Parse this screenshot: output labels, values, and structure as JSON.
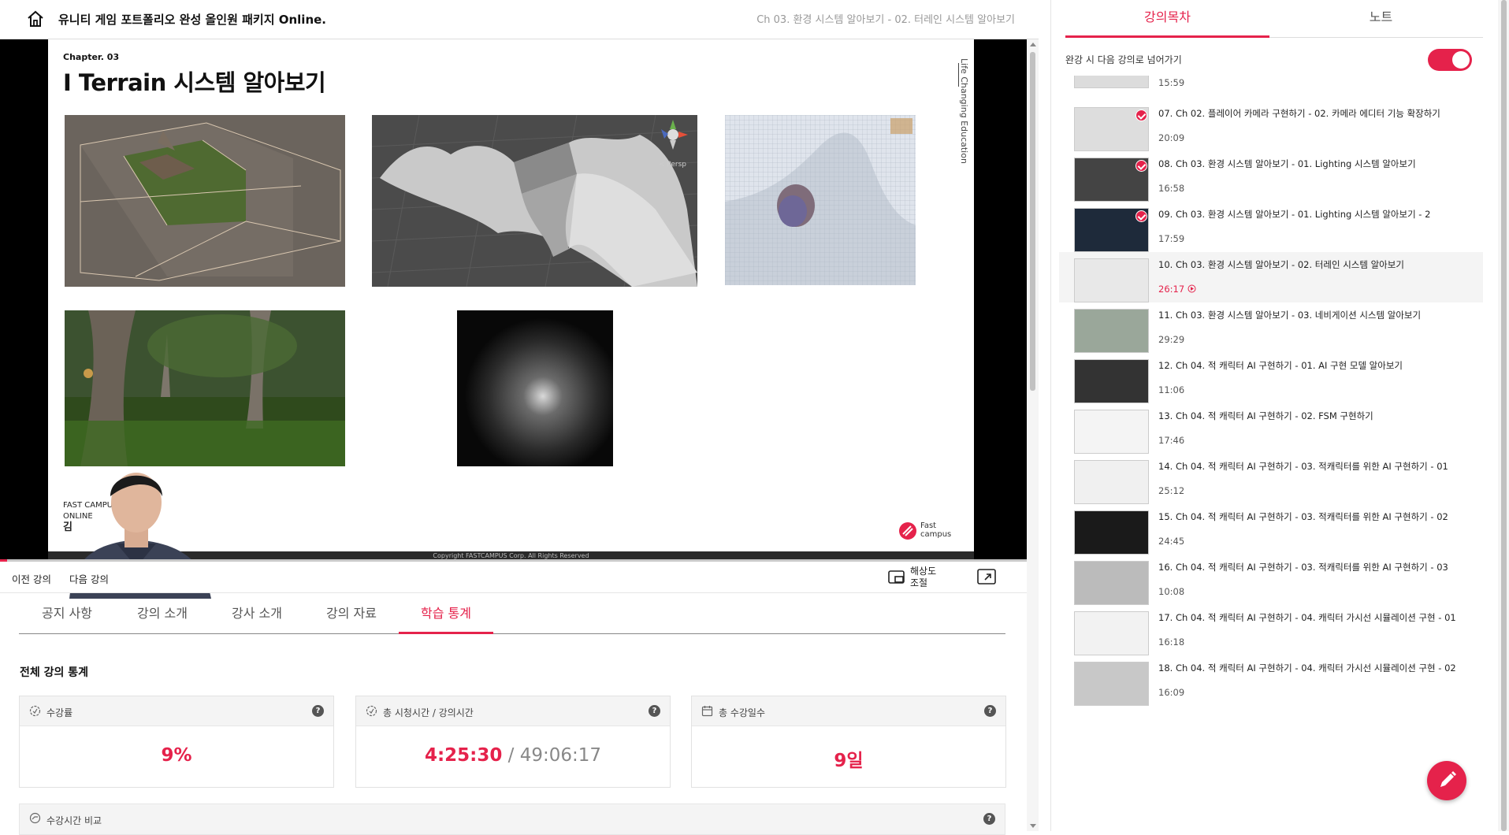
{
  "header": {
    "course_title": "유니티 게임 포트폴리오 완성 올인원 패키지 Online.",
    "current_lecture": "Ch 03. 환경 시스템 알아보기 - 02. 터레인 시스템 알아보기"
  },
  "slide": {
    "chapter_label": "Chapter.   03",
    "title": "I Terrain 시스템 알아보기",
    "side_caption": "Life Changing Education",
    "footer_line1": "FAST CAMPUS",
    "footer_line2": "ONLINE",
    "footer_line3": "김",
    "logo_text_1": "Fast",
    "logo_text_2": "campus",
    "copyright": "Copyright FASTCAMPUS Corp. All Rights Reserved",
    "persp_label": "< Persp"
  },
  "player": {
    "progress_fraction": 0.007
  },
  "controls": {
    "prev_label": "이전 강의",
    "next_label": "다음 강의",
    "resolution_label_1": "해상도",
    "resolution_label_2": "조절"
  },
  "tabs": [
    {
      "label": "공지 사항"
    },
    {
      "label": "강의 소개"
    },
    {
      "label": "강사 소개"
    },
    {
      "label": "강의 자료"
    },
    {
      "label": "학습 통계"
    }
  ],
  "stats": {
    "heading": "전체 강의 통계",
    "progress_label": "수강률",
    "progress_value": "9%",
    "watch_label": "총 시청시간 / 강의시간",
    "watch_value": "4:25:30",
    "watch_separator": " / ",
    "total_value": "49:06:17",
    "days_label": "총 수강일수",
    "days_value": "9일",
    "compare_label": "수강시간 비교",
    "help": "?"
  },
  "sidebar": {
    "tab_curriculum": "강의목차",
    "tab_notes": "노트",
    "autoplay_label": "완강 시 다음 강의로 넘어가기",
    "partial_duration": "15:59",
    "lectures": [
      {
        "title": "07. Ch 02. 플레이어 카메라 구현하기 - 02. 카메라 에디터 기능 확장하기",
        "duration": "20:09"
      },
      {
        "title": "08. Ch 03. 환경 시스템 알아보기 - 01. Lighting 시스템 알아보기",
        "duration": "16:58"
      },
      {
        "title": "09. Ch 03. 환경 시스템 알아보기 - 01. Lighting 시스템 알아보기 - 2",
        "duration": "17:59"
      },
      {
        "title": "10. Ch 03. 환경 시스템 알아보기 - 02. 터레인 시스템 알아보기",
        "duration": "26:17"
      },
      {
        "title": "11. Ch 03. 환경 시스템 알아보기 - 03. 네비게이션 시스템 알아보기",
        "duration": "29:29"
      },
      {
        "title": "12. Ch 04. 적 캐릭터 AI 구현하기 - 01. AI 구현 모델 알아보기",
        "duration": "11:06"
      },
      {
        "title": "13. Ch 04. 적 캐릭터 AI 구현하기 - 02. FSM 구현하기",
        "duration": "17:46"
      },
      {
        "title": "14. Ch 04. 적 캐릭터 AI 구현하기 - 03. 적캐릭터를 위한 AI 구현하기 - 01",
        "duration": "25:12"
      },
      {
        "title": "15. Ch 04. 적 캐릭터 AI 구현하기 - 03. 적캐릭터를 위한 AI 구현하기 - 02",
        "duration": "24:45"
      },
      {
        "title": "16. Ch 04. 적 캐릭터 AI 구현하기 - 03. 적캐릭터를 위한 AI 구현하기 - 03",
        "duration": "10:08"
      },
      {
        "title": "17. Ch 04. 적 캐릭터 AI 구현하기 - 04. 캐릭터 가시선 시뮬레이션 구현 - 01",
        "duration": "16:18"
      },
      {
        "title": "18. Ch 04. 적 캐릭터 AI 구현하기 - 04. 캐릭터 가시선 시뮬레이션 구현 - 02",
        "duration": "16:09"
      }
    ]
  },
  "colors": {
    "accent": "#e5224b"
  }
}
